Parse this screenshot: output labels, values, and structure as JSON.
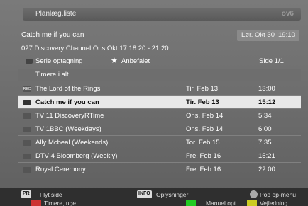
{
  "header": {
    "title": "Planlæg.liste",
    "logo": "ov6"
  },
  "program": {
    "title": "Catch me if you can",
    "detail": "027 Discovery Channel Ons Okt 17    18:20 - 21:20",
    "date": "Lør. Okt 30",
    "time": "19:10"
  },
  "legend": {
    "series": "Serie optagning",
    "recommended": "Anbefalet",
    "page": "Side 1/1"
  },
  "list": {
    "header": "Timere i alt",
    "rows": [
      {
        "icon": "REC",
        "name": "The Lord of the Rings",
        "date": "Tir. Feb 13",
        "time": "13:00"
      },
      {
        "icon": "",
        "name": "Catch me if you can",
        "date": "Tir. Feb 13",
        "time": "15:12"
      },
      {
        "icon": "",
        "name": "TV  11 DiscoveryRTime",
        "date": "Ons. Feb 14",
        "time": "5:34"
      },
      {
        "icon": "",
        "name": "TV  1BBC (Weekdays)",
        "date": "Ons. Feb 14",
        "time": "6:00"
      },
      {
        "icon": "",
        "name": "Ally Mcbeal (Weekends)",
        "date": "Tor. Feb 15",
        "time": "7:35"
      },
      {
        "icon": "",
        "name": "DTV 4 Bloomberg (Weekly)",
        "date": "Fre. Feb 16",
        "time": "15:21"
      },
      {
        "icon": "",
        "name": "Royal Ceremony",
        "date": "Fre. Feb 16",
        "time": "22:00"
      }
    ]
  },
  "footer": {
    "pr_key": "PR",
    "pr_label": "Flyt side",
    "info_key": "INFO",
    "info_label": "Oplysninger",
    "ok_label": "Pop op-menu",
    "timer_label": "Timere, uge",
    "manual_label": "Manuel opt.",
    "guide_label": "Vejledning"
  }
}
